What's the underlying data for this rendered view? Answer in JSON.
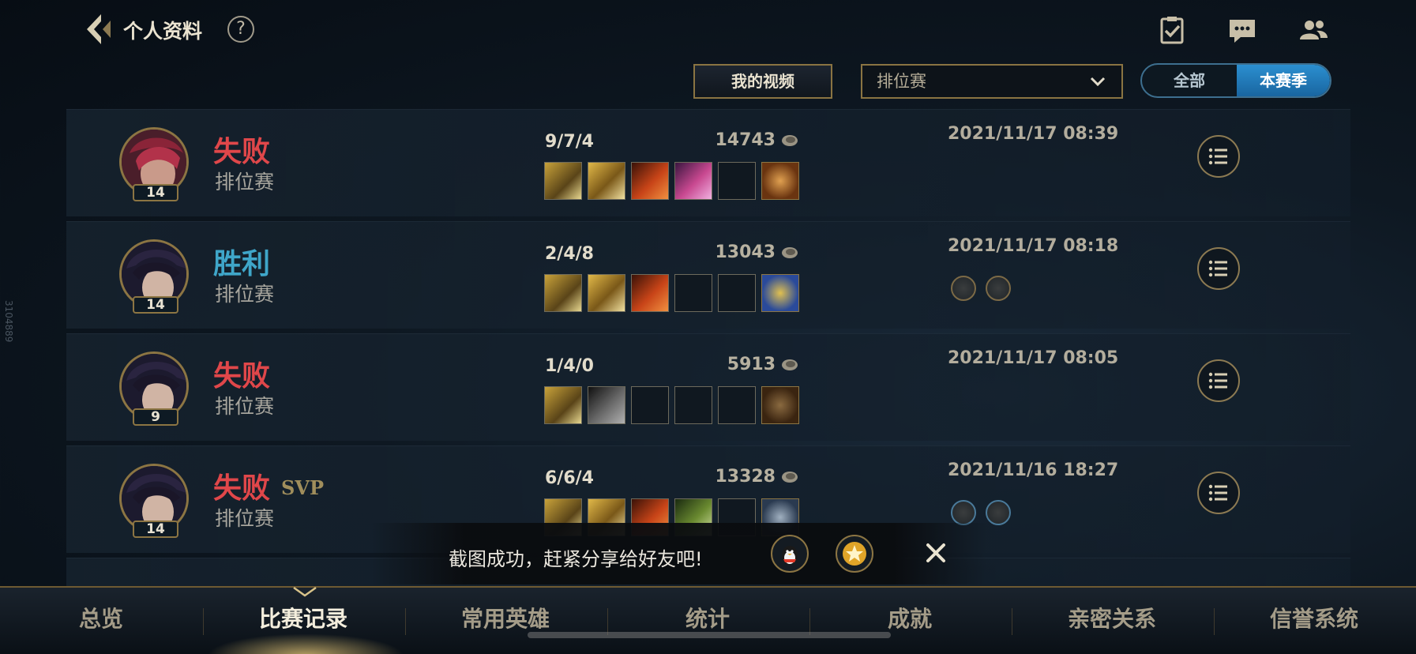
{
  "header": {
    "title": "个人资料",
    "help": "?"
  },
  "controls": {
    "video_button": "我的视频",
    "mode_select_value": "排位赛",
    "toggle_all": "全部",
    "toggle_season": "本赛季"
  },
  "matches": [
    {
      "level": "14",
      "result": "失败",
      "svp": "",
      "mode": "排位赛",
      "kda": "9/7/4",
      "gold": "14743",
      "date": "2021/11/17 08:39"
    },
    {
      "level": "14",
      "result": "胜利",
      "svp": "",
      "mode": "排位赛",
      "kda": "2/4/8",
      "gold": "13043",
      "date": "2021/11/17 08:18"
    },
    {
      "level": "9",
      "result": "失败",
      "svp": "",
      "mode": "排位赛",
      "kda": "1/4/0",
      "gold": "5913",
      "date": "2021/11/17 08:05"
    },
    {
      "level": "14",
      "result": "失败",
      "svp": "SVP",
      "mode": "排位赛",
      "kda": "6/6/4",
      "gold": "13328",
      "date": "2021/11/16 18:27"
    }
  ],
  "toast": {
    "text": "截图成功，赶紧分享给好友吧!"
  },
  "nav": {
    "tabs": [
      "总览",
      "比赛记录",
      "常用英雄",
      "统计",
      "成就",
      "亲密关系",
      "信誉系统"
    ],
    "active_index": 1
  },
  "side_label": "3104889",
  "colors": {
    "loss": "#e0474a",
    "win": "#3fa6c9",
    "gold_border": "#8c7543",
    "toggle_active": "#2b8fd0"
  }
}
